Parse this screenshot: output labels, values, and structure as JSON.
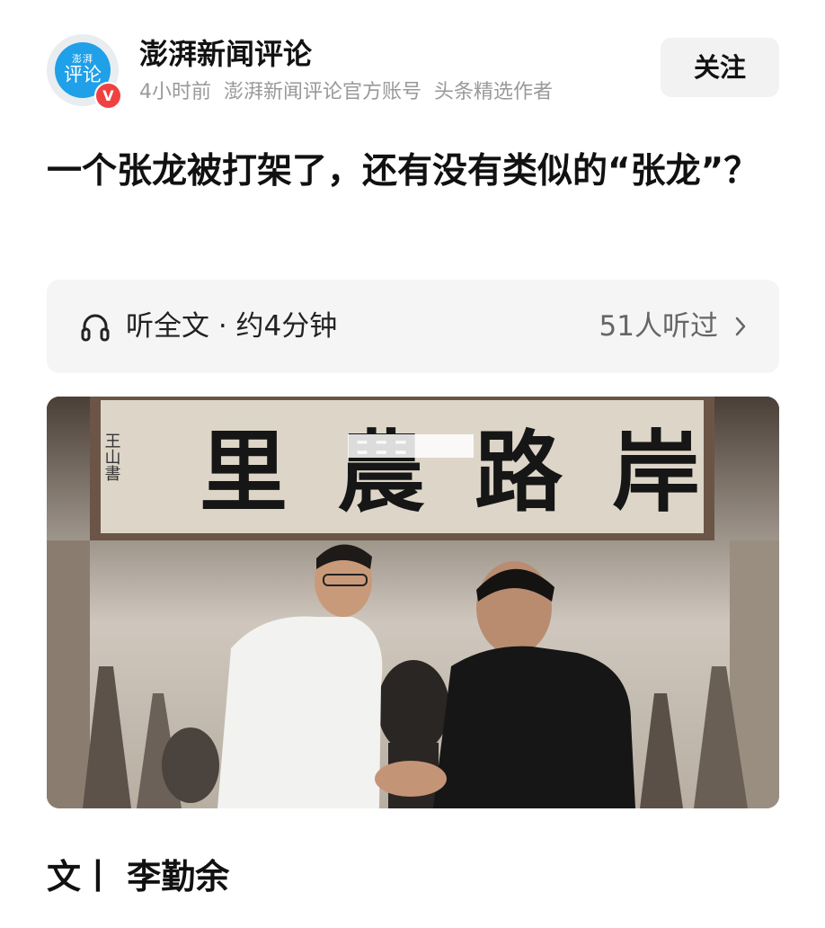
{
  "account": {
    "avatar_text_top": "澎湃",
    "avatar_text_main": "评论",
    "verify_badge": "V",
    "name": "澎湃新闻评论",
    "time": "4小时前",
    "description": "澎湃新闻评论官方账号",
    "tag": "头条精选作者",
    "follow_label": "关注"
  },
  "article": {
    "title": "一个张龙被打架了，还有没有类似的“张龙”？",
    "byline": "文丨 李勤余"
  },
  "listen": {
    "icon": "headphone-icon",
    "label": "听全文 · 约4分钟",
    "count": "51人听过",
    "chevron": "chevron-right-icon"
  },
  "image": {
    "calligraphy": "里農路岸",
    "seal": "王山書"
  },
  "colors": {
    "badge": "#f04142",
    "avatar_blue": "#1fa0e8",
    "meta_gray": "#999999",
    "panel_gray": "#f5f5f5"
  }
}
